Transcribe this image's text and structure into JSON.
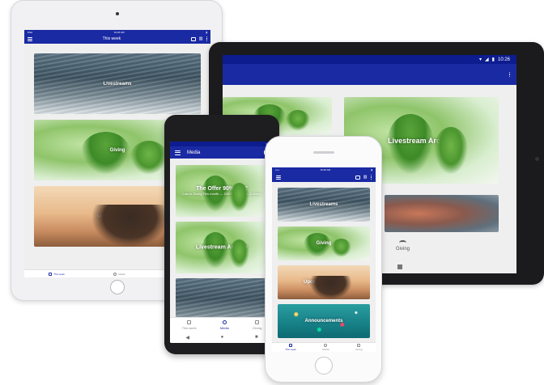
{
  "ipad": {
    "status_left": "iPad",
    "status_time": "10:26 AM",
    "title": "This week",
    "tiles": [
      "Livestreams",
      "Giving",
      "Upcoming events"
    ],
    "tabs": [
      "This week",
      "Media",
      "Giving"
    ]
  },
  "tablet": {
    "status_time": "10:26",
    "tiles": [
      "",
      "Livestream Archive",
      "",
      ""
    ],
    "giving_label": "Giving"
  },
  "pixel": {
    "title": "Media",
    "tile1_title": "The Offer 90% Pt. 2",
    "tile1_sub": "Luis in Giving This month — 2/4/2018 • Series & Jesus",
    "tile2_title": "Livestream Archive",
    "tabs": [
      "This week",
      "Media",
      "Giving"
    ],
    "nav": [
      "◀",
      "●",
      "■"
    ]
  },
  "iphone": {
    "status_left": "•••••",
    "status_time": "10:26 AM",
    "tiles": [
      "Livestreams",
      "Giving",
      "Upcoming events",
      "Announcements"
    ],
    "tabs": [
      "This week",
      "Media",
      "Giving"
    ]
  },
  "colors": {
    "app_bar": "#1a2aa3",
    "status_bar": "#0d1c8f",
    "active_tab": "#1a2aa3"
  }
}
